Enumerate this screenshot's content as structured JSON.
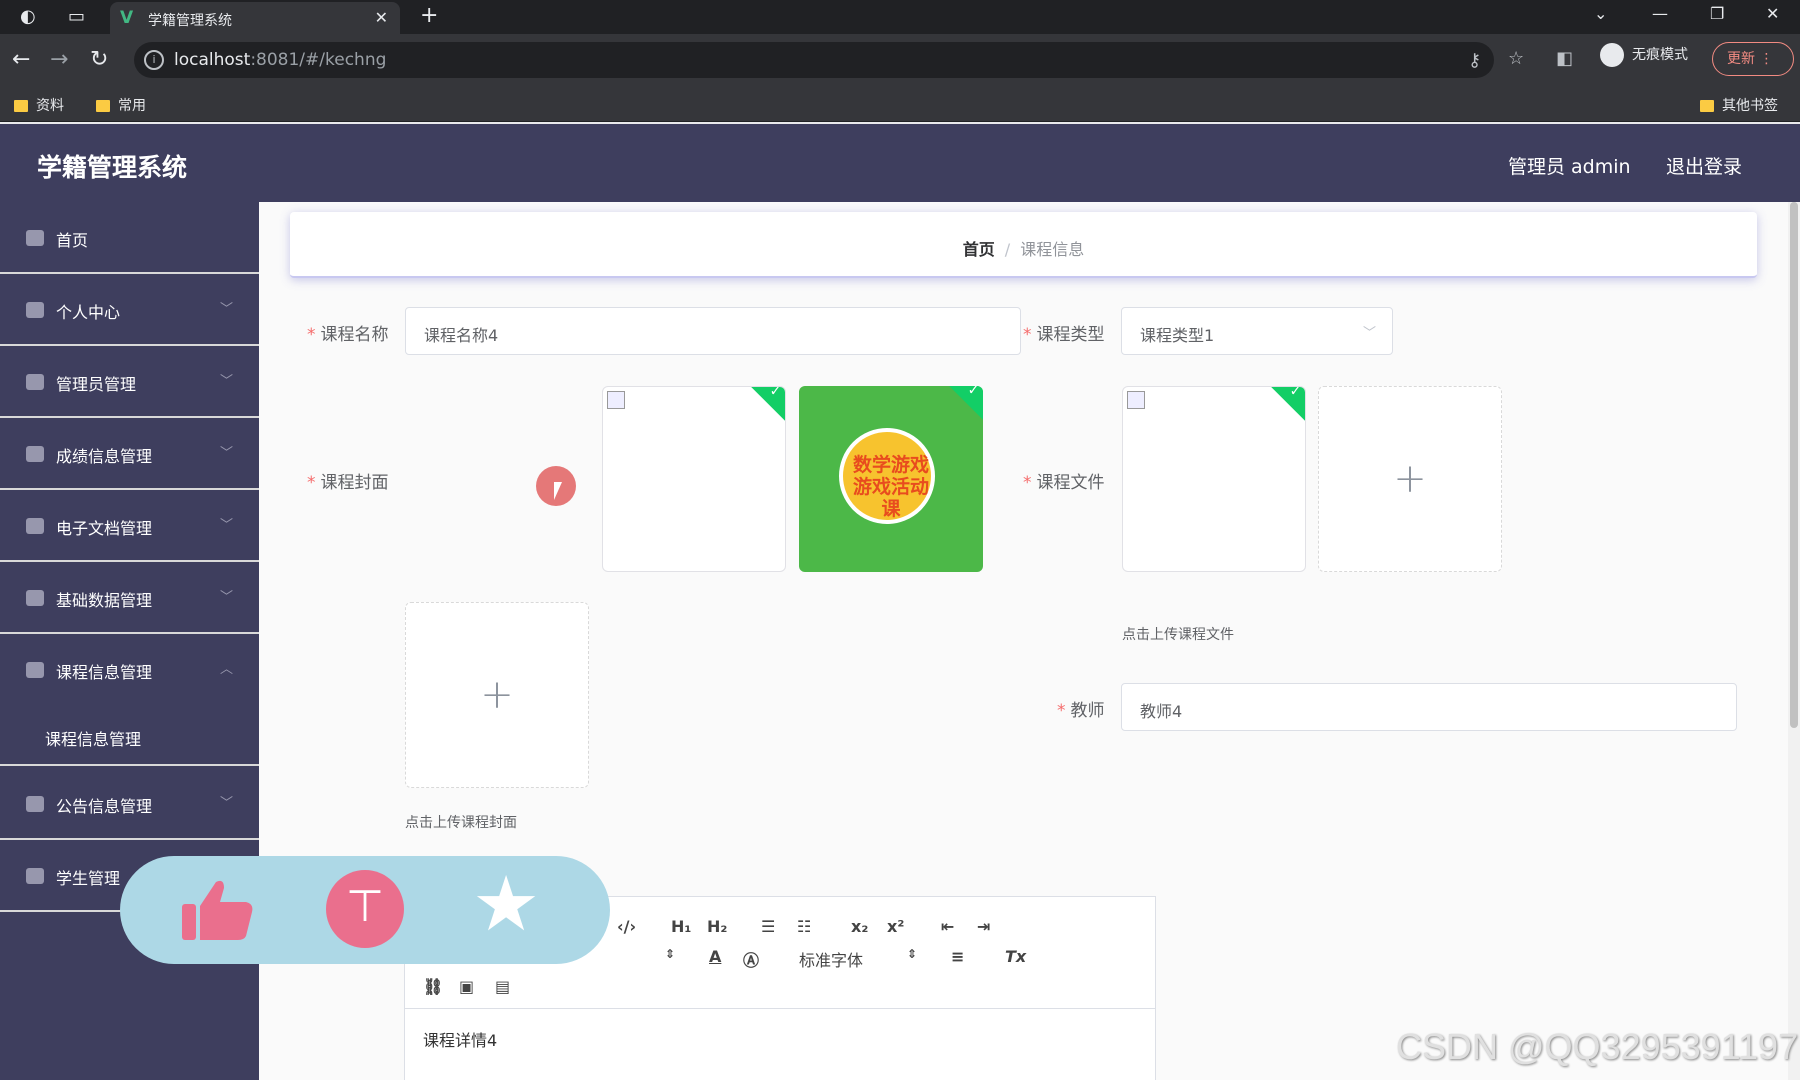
{
  "browser": {
    "tab_title": "学籍管理系统",
    "tab_logo": "V",
    "url_host": "localhost",
    "url_rest": ":8081/#/kechng",
    "incognito_label": "无痕模式",
    "update_label": "更新",
    "bookmarks": [
      "资料",
      "常用"
    ],
    "other_bookmarks": "其他书签"
  },
  "app": {
    "title": "学籍管理系统",
    "user_info": "管理员 admin",
    "logout": "退出登录"
  },
  "sidebar": {
    "items": [
      {
        "label": "首页",
        "icon": "home-icon"
      },
      {
        "label": "个人中心",
        "icon": "user-icon"
      },
      {
        "label": "管理员管理",
        "icon": "admin-icon"
      },
      {
        "label": "成绩信息管理",
        "icon": "mic-icon"
      },
      {
        "label": "电子文档管理",
        "icon": "document-icon"
      },
      {
        "label": "基础数据管理",
        "icon": "bar-chart-icon"
      },
      {
        "label": "课程信息管理",
        "icon": "course-icon"
      },
      {
        "label": "公告信息管理",
        "icon": "notice-icon"
      },
      {
        "label": "学生管理",
        "icon": "student-icon"
      }
    ],
    "sub_item": "课程信息管理"
  },
  "breadcrumb": {
    "home": "首页",
    "separator": "/",
    "current": "课程信息"
  },
  "form": {
    "course_name": {
      "label": "课程名称",
      "value": "课程名称4"
    },
    "course_type": {
      "label": "课程类型",
      "value": "课程类型1"
    },
    "course_cover": {
      "label": "课程封面",
      "hint": "点击上传课程封面"
    },
    "course_file": {
      "label": "课程文件",
      "hint": "点击上传课程文件"
    },
    "teacher": {
      "label": "教师",
      "value": "教师4"
    },
    "cover_thumb_text": "数学游戏\n游戏活动课"
  },
  "editor": {
    "font_label": "标准字体",
    "content": "课程详情4"
  },
  "watermark": "CSDN @QQ3295391197",
  "colors": {
    "sidebar_bg": "#3e3e5e",
    "accent_required": "#f56c6c",
    "upload_success": "#13ce66"
  }
}
